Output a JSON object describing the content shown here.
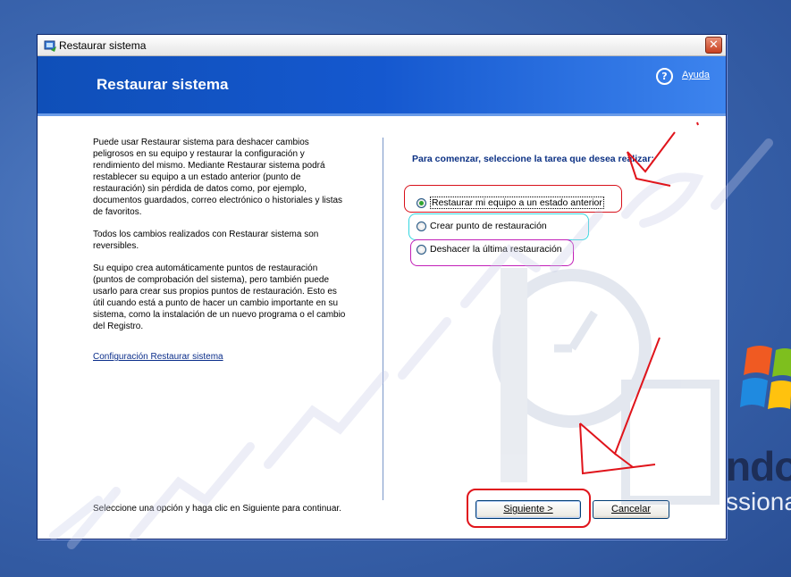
{
  "desktop": {
    "brand_text": "ndow",
    "edition_text": "ssiona"
  },
  "window": {
    "title": "Restaurar sistema",
    "close_glyph": "✕",
    "header_title": "Restaurar sistema",
    "help_label": "Ayuda",
    "help_glyph": "?"
  },
  "left": {
    "paragraphs": [
      "Puede usar Restaurar sistema para deshacer cambios peligrosos en su equipo y restaurar la configuración y rendimiento del mismo. Mediante Restaurar sistema podrá restablecer su equipo a un estado anterior (punto de restauración) sin pérdida de datos como, por ejemplo, documentos guardados, correo electrónico o historiales y listas de favoritos.",
      "Todos los cambios realizados con Restaurar sistema son reversibles.",
      "Su equipo crea automáticamente puntos de restauración (puntos de comprobación del sistema), pero también puede usarlo para crear sus propios puntos de restauración. Esto es útil cuando está a punto de hacer un cambio importante en su sistema, como la instalación de un nuevo programa o el cambio del Registro."
    ],
    "config_link": "Configuración Restaurar sistema"
  },
  "right": {
    "prompt": "Para comenzar, seleccione la tarea que desea realizar:",
    "options": [
      {
        "label": "Restaurar mi equipo a un estado anterior",
        "checked": true
      },
      {
        "label": "Crear punto de restauración",
        "checked": false
      },
      {
        "label": "Deshacer la última restauración",
        "checked": false
      }
    ]
  },
  "footer": {
    "instruction": "Seleccione una opción y haga clic en Siguiente para continuar.",
    "next_label": "Siguiente >",
    "cancel_label": "Cancelar"
  },
  "colors": {
    "header_blue": "#1558cf",
    "annotation_red": "#d8101a",
    "annotation_cyan": "#33d6e0",
    "annotation_magenta": "#c21fb8"
  }
}
